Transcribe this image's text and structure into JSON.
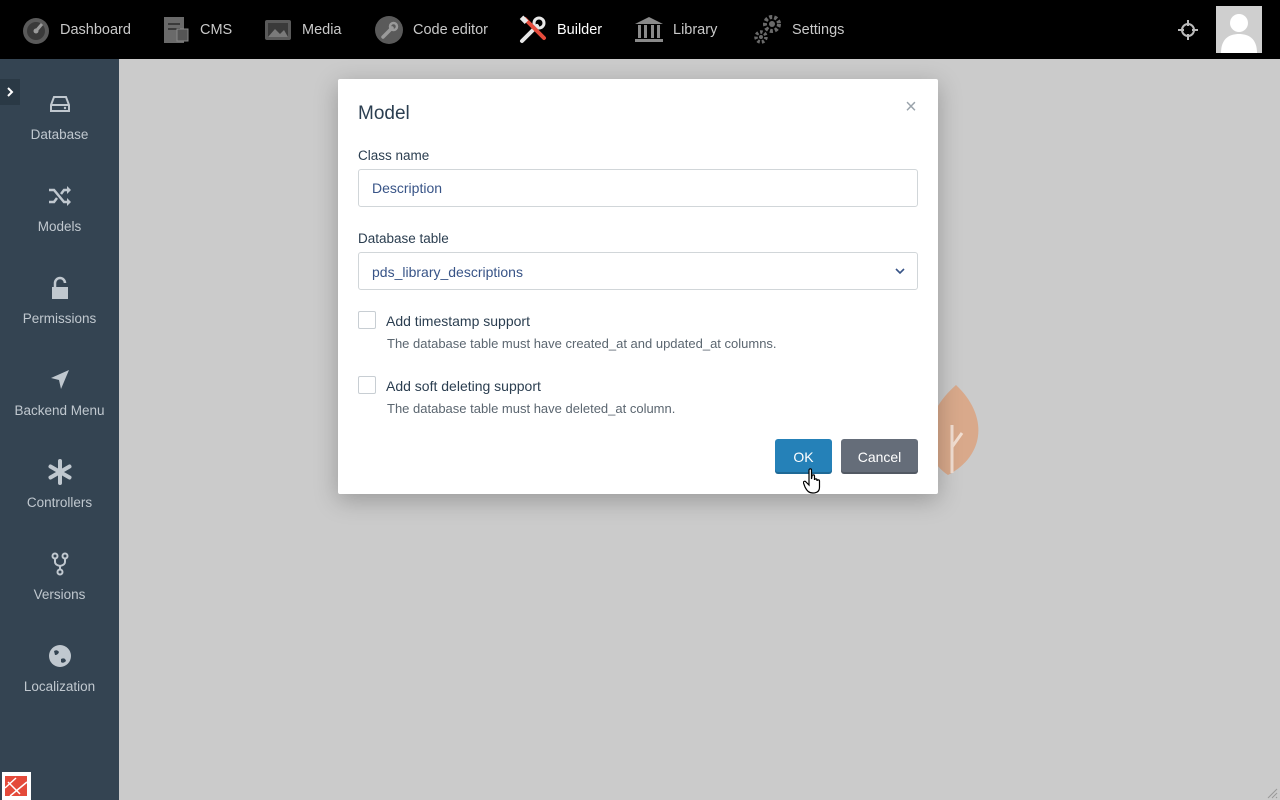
{
  "topnav": {
    "items": [
      {
        "label": "Dashboard",
        "icon": "dashboard-icon"
      },
      {
        "label": "CMS",
        "icon": "cms-icon"
      },
      {
        "label": "Media",
        "icon": "media-icon"
      },
      {
        "label": "Code editor",
        "icon": "wrench-icon"
      },
      {
        "label": "Builder",
        "icon": "builder-icon",
        "active": true
      },
      {
        "label": "Library",
        "icon": "library-icon"
      },
      {
        "label": "Settings",
        "icon": "gears-icon"
      }
    ]
  },
  "sidebar": {
    "items": [
      {
        "label": "Database",
        "icon": "database-icon"
      },
      {
        "label": "Models",
        "icon": "shuffle-icon"
      },
      {
        "label": "Permissions",
        "icon": "unlock-icon"
      },
      {
        "label": "Backend Menu",
        "icon": "location-arrow-icon"
      },
      {
        "label": "Controllers",
        "icon": "asterisk-icon"
      },
      {
        "label": "Versions",
        "icon": "code-fork-icon"
      },
      {
        "label": "Localization",
        "icon": "globe-icon"
      }
    ]
  },
  "modal": {
    "title": "Model",
    "close": "×",
    "class_name": {
      "label": "Class name",
      "value": "Description"
    },
    "database_table": {
      "label": "Database table",
      "value": "pds_library_descriptions"
    },
    "timestamp": {
      "label": "Add timestamp support",
      "help": "The database table must have created_at and updated_at columns.",
      "checked": false
    },
    "soft_delete": {
      "label": "Add soft deleting support",
      "help": "The database table must have deleted_at column.",
      "checked": false
    },
    "ok_label": "OK",
    "cancel_label": "Cancel"
  },
  "colors": {
    "topbar": "#000000",
    "sidebar": "#344452",
    "primary": "#2581b8",
    "secondary": "#656d79",
    "builder_accent": "#e74c3c"
  }
}
